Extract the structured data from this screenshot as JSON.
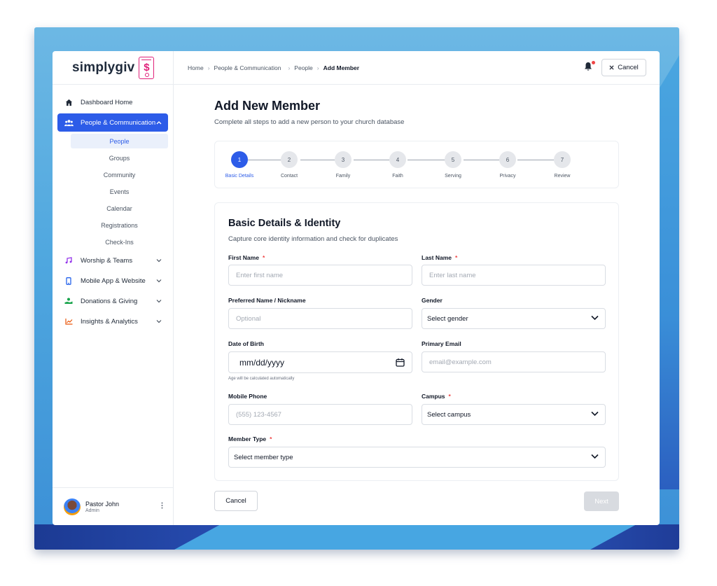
{
  "brand": {
    "name": "simplygiv",
    "logo_glyph": "$"
  },
  "sidebar": {
    "items": [
      {
        "label": "Dashboard Home",
        "icon": "home-icon",
        "color": "#1f2937"
      },
      {
        "label": "People & Communication",
        "icon": "users-icon",
        "active": true,
        "expanded": true
      },
      {
        "label": "Worship & Teams",
        "icon": "music-note-icon",
        "color": "#9333ea"
      },
      {
        "label": "Mobile App & Website",
        "icon": "mobile-icon",
        "color": "#2563eb"
      },
      {
        "label": "Donations & Giving",
        "icon": "hand-coin-icon",
        "color": "#16a34a"
      },
      {
        "label": "Insights & Analytics",
        "icon": "line-chart-icon",
        "color": "#ea580c"
      }
    ],
    "sub_items": [
      "People",
      "Groups",
      "Community",
      "Events",
      "Calendar",
      "Registrations",
      "Check-Ins"
    ],
    "current_sub": "People"
  },
  "profile": {
    "name": "Pastor John",
    "role": "Admin"
  },
  "breadcrumb": [
    "Home",
    "People & Communication",
    "People",
    "Add Member"
  ],
  "topbar": {
    "cancel_label": "Cancel"
  },
  "page": {
    "title": "Add New Member",
    "subtitle": "Complete all steps to add a new person to your church database"
  },
  "steps": [
    {
      "num": "1",
      "label": "Basic Details"
    },
    {
      "num": "2",
      "label": "Contact"
    },
    {
      "num": "3",
      "label": "Family"
    },
    {
      "num": "4",
      "label": "Faith"
    },
    {
      "num": "5",
      "label": "Serving"
    },
    {
      "num": "6",
      "label": "Privacy"
    },
    {
      "num": "7",
      "label": "Review"
    }
  ],
  "form": {
    "title": "Basic Details & Identity",
    "subtitle": "Capture core identity information and check for duplicates",
    "first_name": {
      "label": "First Name",
      "placeholder": "Enter first name",
      "required": "*"
    },
    "last_name": {
      "label": "Last Name",
      "placeholder": "Enter last name",
      "required": "*"
    },
    "preferred_name": {
      "label": "Preferred Name / Nickname",
      "placeholder": "Optional"
    },
    "gender": {
      "label": "Gender",
      "value": "Select gender"
    },
    "dob": {
      "label": "Date of Birth",
      "value": "mm/dd/yyyy",
      "hint": "Age will be calculated automatically"
    },
    "email": {
      "label": "Primary Email",
      "placeholder": "email@example.com"
    },
    "phone": {
      "label": "Mobile Phone",
      "placeholder": "(555) 123-4567"
    },
    "campus": {
      "label": "Campus",
      "value": "Select campus",
      "required": "*"
    },
    "member_type": {
      "label": "Member Type",
      "value": "Select member type",
      "required": "*"
    }
  },
  "footer": {
    "cancel_label": "Cancel",
    "next_label": "Next"
  },
  "colors": {
    "accent": "#2d5ce8",
    "required": "#ef4444",
    "logo": "#e0217a"
  }
}
